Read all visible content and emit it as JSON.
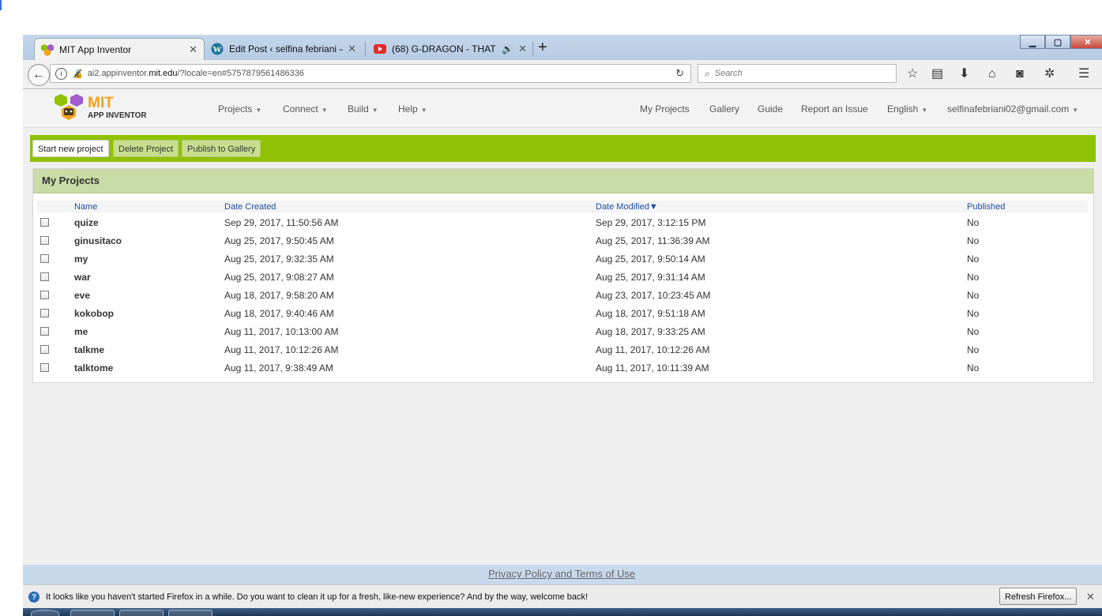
{
  "browser": {
    "tabs": [
      {
        "title": "MIT App Inventor",
        "active": true
      },
      {
        "title": "Edit Post ‹ selfina febriani — ",
        "active": false
      },
      {
        "title": "(68) G-DRAGON - THAT X",
        "active": false
      }
    ],
    "url_prefix": "ai2.appinventor.",
    "url_domain": "mit.edu",
    "url_suffix": "/?locale=en#5757879561486336",
    "search_placeholder": "Search"
  },
  "header": {
    "logo_mit": "MIT",
    "logo_sub": "APP INVENTOR",
    "menus": [
      "Projects",
      "Connect",
      "Build",
      "Help"
    ],
    "right_links": [
      "My Projects",
      "Gallery",
      "Guide",
      "Report an Issue"
    ],
    "language": "English",
    "account": "selfinafebriani02@gmail.com"
  },
  "toolbar": {
    "start_new": "Start new project",
    "delete": "Delete Project",
    "publish": "Publish to Gallery"
  },
  "projects": {
    "title": "My Projects",
    "columns": {
      "name": "Name",
      "created": "Date Created",
      "modified": "Date Modified▼",
      "published": "Published"
    },
    "rows": [
      {
        "name": "quize",
        "created": "Sep 29, 2017, 11:50:56 AM",
        "modified": "Sep 29, 2017, 3:12:15 PM",
        "published": "No"
      },
      {
        "name": "ginusitaco",
        "created": "Aug 25, 2017, 9:50:45 AM",
        "modified": "Aug 25, 2017, 11:36:39 AM",
        "published": "No"
      },
      {
        "name": "my",
        "created": "Aug 25, 2017, 9:32:35 AM",
        "modified": "Aug 25, 2017, 9:50:14 AM",
        "published": "No"
      },
      {
        "name": "war",
        "created": "Aug 25, 2017, 9:08:27 AM",
        "modified": "Aug 25, 2017, 9:31:14 AM",
        "published": "No"
      },
      {
        "name": "eve",
        "created": "Aug 18, 2017, 9:58:20 AM",
        "modified": "Aug 23, 2017, 10:23:45 AM",
        "published": "No"
      },
      {
        "name": "kokobop",
        "created": "Aug 18, 2017, 9:40:46 AM",
        "modified": "Aug 18, 2017, 9:51:18 AM",
        "published": "No"
      },
      {
        "name": "me",
        "created": "Aug 11, 2017, 10:13:00 AM",
        "modified": "Aug 18, 2017, 9:33:25 AM",
        "published": "No"
      },
      {
        "name": "talkme",
        "created": "Aug 11, 2017, 10:12:26 AM",
        "modified": "Aug 11, 2017, 10:12:26 AM",
        "published": "No"
      },
      {
        "name": "talktome",
        "created": "Aug 11, 2017, 9:38:49 AM",
        "modified": "Aug 11, 2017, 10:11:39 AM",
        "published": "No"
      }
    ]
  },
  "footer": {
    "privacy": "Privacy Policy and Terms of Use"
  },
  "notification": {
    "message": "It looks like you haven't started Firefox in a while. Do you want to clean it up for a fresh, like-new experience? And by the way, welcome back!",
    "refresh_label": "Refresh Firefox..."
  },
  "colors": {
    "toolbar_green": "#8fc202",
    "panel_header": "#c9dba6",
    "logo_orange": "#f7a11a",
    "link_blue": "#1d4fa0"
  }
}
